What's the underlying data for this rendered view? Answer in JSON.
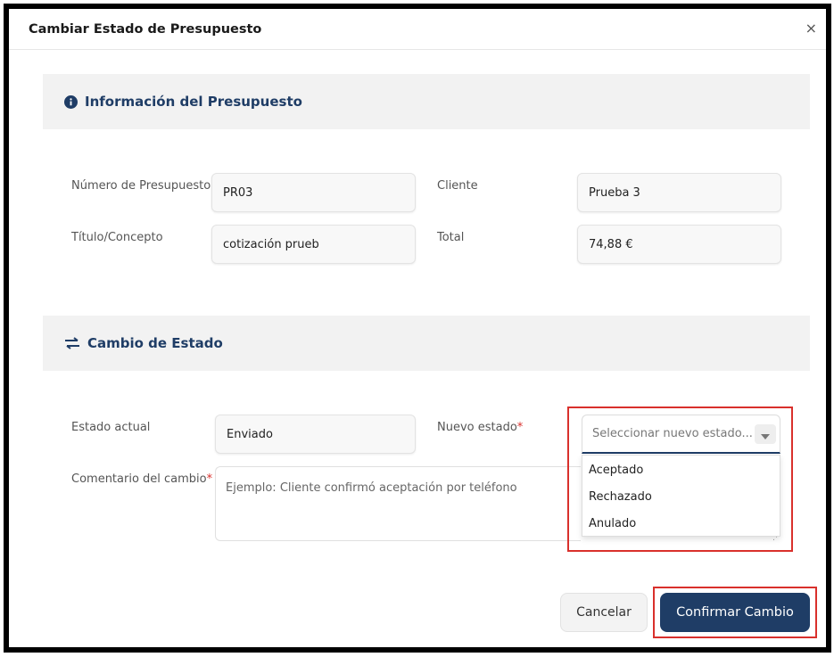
{
  "modal": {
    "title": "Cambiar Estado de Presupuesto",
    "close_label": "×"
  },
  "info_section": {
    "title": "Información del Presupuesto",
    "icon": "info-circle-icon",
    "fields": {
      "numero_label": "Número de Presupuesto",
      "numero_value": "PR03",
      "cliente_label": "Cliente",
      "cliente_value": "Prueba 3",
      "titulo_label": "Título/Concepto",
      "titulo_value": "cotización prueb",
      "total_label": "Total",
      "total_value": "74,88 €"
    }
  },
  "estado_section": {
    "title": "Cambio de Estado",
    "icon": "exchange-arrows-icon",
    "estado_actual_label": "Estado actual",
    "estado_actual_value": "Enviado",
    "nuevo_estado_label": "Nuevo estado",
    "nuevo_estado_placeholder": "Seleccionar nuevo estado...",
    "required_mark": "*",
    "options": [
      "Aceptado",
      "Rechazado",
      "Anulado"
    ],
    "comentario_label": "Comentario del cambio",
    "comentario_placeholder": "Ejemplo: Cliente confirmó aceptación por teléfono"
  },
  "footer": {
    "cancel_label": "Cancelar",
    "confirm_label": "Confirmar Cambio"
  },
  "colors": {
    "primary": "#1f3d66",
    "highlight": "#d9302c",
    "section_bg": "#f2f2f2"
  }
}
